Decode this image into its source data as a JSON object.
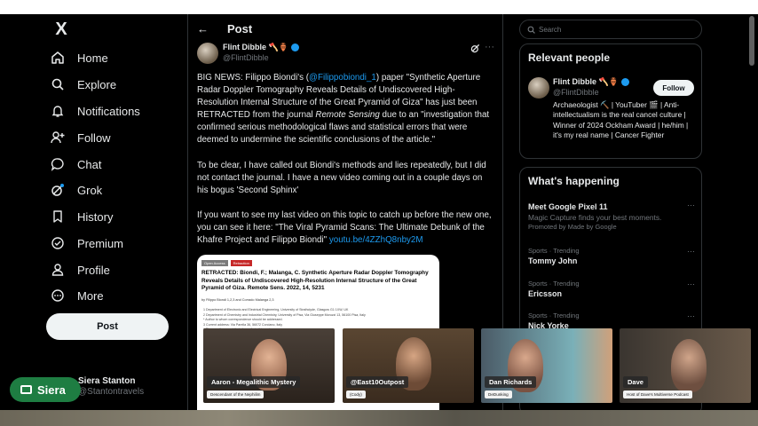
{
  "nav": {
    "logo": "X",
    "items": [
      {
        "label": "Home",
        "icon": "home-icon"
      },
      {
        "label": "Explore",
        "icon": "search-icon"
      },
      {
        "label": "Notifications",
        "icon": "bell-icon"
      },
      {
        "label": "Follow",
        "icon": "person-add-icon"
      },
      {
        "label": "Chat",
        "icon": "chat-icon"
      },
      {
        "label": "Grok",
        "icon": "grok-icon"
      },
      {
        "label": "History",
        "icon": "bookmark-icon"
      },
      {
        "label": "Premium",
        "icon": "check-badge-icon"
      },
      {
        "label": "Profile",
        "icon": "person-icon"
      },
      {
        "label": "More",
        "icon": "more-circle-icon"
      }
    ],
    "post_label": "Post",
    "account": {
      "name": "Siera Stanton",
      "handle": "@Stantontravels",
      "more": "···"
    }
  },
  "main": {
    "header": {
      "back": "←",
      "title": "Post"
    },
    "author": {
      "name": "Flint Dibble 🪓🏺",
      "handle": "@FlintDibble"
    },
    "paragraph1": {
      "pre": "BIG NEWS: Filippo Biondi's (",
      "mention": "@Filippobiondi_1",
      "mid": ") paper \"Synthetic Aperture Radar Doppler Tomography Reveals Details of Undiscovered High-Resolution Internal Structure of the Great Pyramid of Giza\" has just been RETRACTED from the journal ",
      "journal": "Remote Sensing",
      "post": " due to an \"investigation that confirmed serious methodological flaws and statistical errors that were deemed to undermine the scientific conclusions of the article.\""
    },
    "paragraph2": "To be clear, I have called out Biondi's methods and lies repeatedly, but I did not contact the journal. I have a new video coming out in a couple days on his bogus 'Second Sphinx'",
    "paragraph3": {
      "pre": "If you want to see my last video on this topic to catch up before the new one, you can see it here: \"The Viral Pyramid Scans: The Ultimate Debunk of the Khafre Project and Filippo Biondi\" ",
      "link": "youtu.be/4ZZhQ8nby2M"
    },
    "embed": {
      "tag_open": "Open Access",
      "tag_retracted": "Retraction",
      "title": "RETRACTED: Biondi, F.; Malanga, C. Synthetic Aperture Radar Doppler Tomography Reveals Details of Undiscovered High-Resolution Internal Structure of the Great Pyramid of Giza. Remote Sens. 2022, 14, 5231",
      "authors": "by Filippo Biondi 1,2,3 and Corrado Malanga 2,3",
      "aff1": "1 Department of Electronic and Electrical Engineering, University of Strathclyde, Glasgow G1 1XW, UK",
      "aff2": "2 Department of Chemistry and Industrial Chemistry, University of Pisa, Via Giuseppe Moruzzi 13, 56100 Pisa, Italy",
      "aff3": "* Author to whom correspondence should be addressed.",
      "aff4": "3 Current address: Via Parella 36, 56072 Corciano, Italy",
      "aff5": "† These authors contributed equally to this work."
    }
  },
  "right": {
    "search_placeholder": "Search",
    "relevant": {
      "title": "Relevant people",
      "name": "Flint Dibble 🪓🏺",
      "handle": "@FlintDibble",
      "follow": "Follow",
      "bio": "Archaeologist ⛏️ | YouTuber 🎬 | Anti-intellectualism is the real cancel culture | Winner of 2024 Ockham Award | he/him | it's my real name | Cancer Fighter"
    },
    "happening": {
      "title": "What's happening",
      "trends": [
        {
          "context": "",
          "title": "Meet Google Pixel 11",
          "sub": "Magic Capture finds your best moments.",
          "sub2": "Promoted by Made by Google"
        },
        {
          "context": "Sports · Trending",
          "title": "Tommy John",
          "sub": "",
          "sub2": ""
        },
        {
          "context": "Sports · Trending",
          "title": "Ericsson",
          "sub": "",
          "sub2": ""
        },
        {
          "context": "Sports · Trending",
          "title": "Nick Yorke",
          "sub": "",
          "sub2": ""
        }
      ],
      "more": "···"
    }
  },
  "overlay": {
    "host": "Siera",
    "guests": [
      {
        "name": "Aaron - Megalithic Mystery",
        "sub": "Descendant of the Nephilim"
      },
      {
        "name": "@East10Outpost",
        "sub": "(Cody)"
      },
      {
        "name": "Dan Richards",
        "sub": "DeDunking"
      },
      {
        "name": "Dave",
        "sub": "Host of Dave's Multiverse Podcast"
      }
    ]
  },
  "colors": {
    "accent": "#1d9bf0",
    "host_badge": "#1e7d42",
    "retracted_tag": "#c62828"
  }
}
